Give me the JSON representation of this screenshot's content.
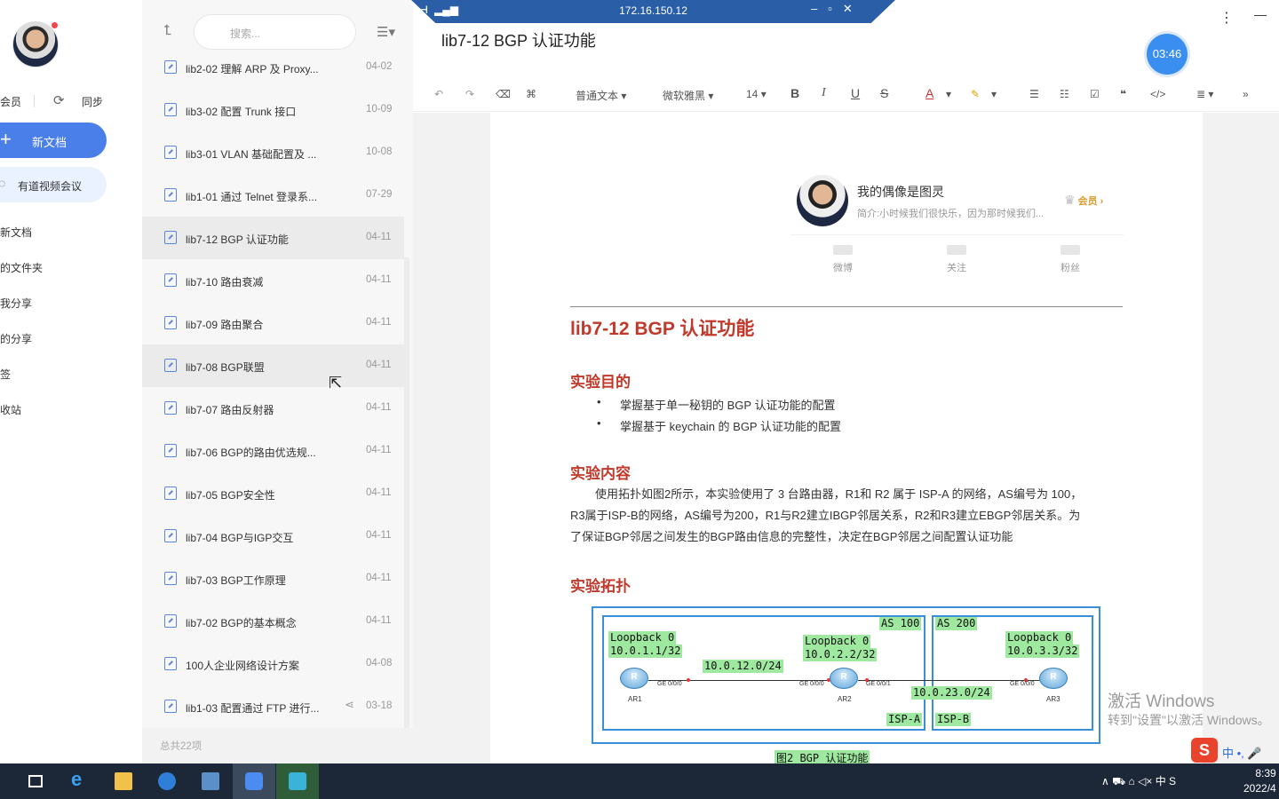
{
  "sidebar": {
    "member": "会员",
    "sync": "同步",
    "new_doc": "新文档",
    "meeting": "有道视频会议",
    "nav": [
      "新文档",
      "的文件夹",
      "我分享",
      "的分享",
      "签",
      "收站"
    ]
  },
  "list": {
    "search_placeholder": "搜索...",
    "total": "总共22项",
    "items": [
      {
        "title": "lib2-02 理解 ARP 及 Proxy...",
        "date": "04-02"
      },
      {
        "title": "lib3-02 配置 Trunk 接口",
        "date": "10-09"
      },
      {
        "title": "lib3-01 VLAN 基础配置及 ...",
        "date": "10-08"
      },
      {
        "title": "lib1-01 通过 Telnet 登录系...",
        "date": "07-29"
      },
      {
        "title": "lib7-12 BGP 认证功能",
        "date": "04-11"
      },
      {
        "title": "lib7-10 路由衰减",
        "date": "04-11"
      },
      {
        "title": "lib7-09 路由聚合",
        "date": "04-11"
      },
      {
        "title": "lib7-08 BGP联盟",
        "date": "04-11"
      },
      {
        "title": "lib7-07 路由反射器",
        "date": "04-11"
      },
      {
        "title": "lib7-06 BGP的路由优选规...",
        "date": "04-11"
      },
      {
        "title": "lib7-05 BGP安全性",
        "date": "04-11"
      },
      {
        "title": "lib7-04 BGP与IGP交互",
        "date": "04-11"
      },
      {
        "title": "lib7-03 BGP工作原理",
        "date": "04-11"
      },
      {
        "title": "lib7-02 BGP的基本概念",
        "date": "04-11"
      },
      {
        "title": "100人企业网络设计方案",
        "date": "04-08"
      },
      {
        "title": "lib1-03 配置通过 FTP 进行...",
        "date": "03-18"
      }
    ]
  },
  "remote": {
    "ip": "172.16.150.12"
  },
  "doc": {
    "title": "lib7-12 BGP 认证功能",
    "timer": "03:46",
    "toolbar": {
      "style": "普通文本",
      "font": "微软雅黑",
      "size": "14"
    },
    "author": {
      "name": "我的偶像是图灵",
      "bio": "简介:小时候我们很快乐，因为那时候我们...",
      "vip": "会员",
      "stats": [
        "微博",
        "关注",
        "粉丝"
      ]
    },
    "heading": "lib7-12 BGP 认证功能",
    "sec1": "实验目的",
    "bullets": [
      "掌握基于单一秘钥的 BGP 认证功能的配置",
      "掌握基于 keychain 的 BGP 认证功能的配置"
    ],
    "sec2": "实验内容",
    "para": [
      "使用拓扑如图2所示，本实验使用了 3 台路由器，R1和 R2 属于 ISP-A 的网络，AS编号为 100，",
      "R3属于ISP-B的网络，AS编号为200，R1与R2建立IBGP邻居关系，R2和R3建立EBGP邻居关系。为",
      "了保证BGP邻居之间发生的BGP路由信息的完整性，决定在BGP邻居之间配置认证功能"
    ],
    "sec3": "实验拓扑",
    "topo": {
      "as100": "AS 100",
      "as200": "AS 200",
      "lb1a": "Loopback 0",
      "lb1b": "10.0.1.1/32",
      "lb2a": "Loopback 0",
      "lb2b": "10.0.2.2/32",
      "lb3a": "Loopback 0",
      "lb3b": "10.0.3.3/32",
      "net12": "10.0.12.0/24",
      "net23": "10.0.23.0/24",
      "ispa": "ISP-A",
      "ispb": "ISP-B",
      "r1": "AR1",
      "r2": "AR2",
      "r3": "AR3",
      "p1": "GE 0/0/0",
      "p2a": "GE 0/0/0",
      "p2b": "GE 0/0/1",
      "p3": "GE 0/0/0",
      "caption": "图2 BGP 认证功能"
    }
  },
  "watermark": {
    "line1": "激活 Windows",
    "line2": "转到\"设置\"以激活 Windows。"
  },
  "ime": {
    "text": "中 •, 🎤"
  },
  "taskbar": {
    "tray": "∧  ⛟  ⌂  ◁×  中  S",
    "time": "8:39",
    "date": "2022/4"
  },
  "colors": {
    "accent": "#4a7ee8",
    "heading_red": "#c0392b",
    "topo_green": "#9fe89f",
    "topo_blue": "#3a8fd8"
  }
}
